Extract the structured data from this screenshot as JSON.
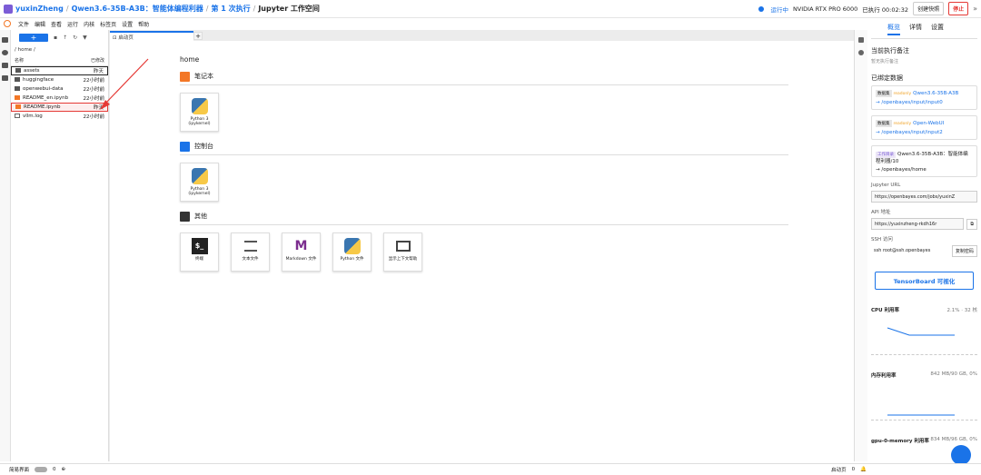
{
  "breadcrumb": {
    "user": "yuxinZheng",
    "project": "Qwen3.6-35B-A3B：智能体编程利器",
    "run": "第 1 次执行",
    "workspace": "Jupyter 工作空间"
  },
  "header": {
    "status": "运行中",
    "gpu": "NVIDIA RTX PRO 6000",
    "timer": "已执行 00:02:32",
    "snapshot": "创建快照",
    "stop": "停止"
  },
  "menu": [
    "文件",
    "编辑",
    "查看",
    "运行",
    "内核",
    "标签页",
    "设置",
    "帮助"
  ],
  "filebrowser": {
    "new_btn": "+",
    "path": "/ home /",
    "col_name": "名称",
    "col_modified": "已修改",
    "files": [
      {
        "name": "assets",
        "time": "昨天",
        "type": "folder"
      },
      {
        "name": "huggingface",
        "time": "22小时前",
        "type": "folder"
      },
      {
        "name": "openwebui-data",
        "time": "22小时前",
        "type": "folder"
      },
      {
        "name": "README_en.ipynb",
        "time": "22小时前",
        "type": "nb"
      },
      {
        "name": "README.ipynb",
        "time": "昨天",
        "type": "nb"
      },
      {
        "name": "vllm.log",
        "time": "22小时前",
        "type": "doc"
      }
    ]
  },
  "tab": {
    "label": "启动页"
  },
  "launcher": {
    "home": "home",
    "notebook_title": "笔记本",
    "console_title": "控制台",
    "other_title": "其他",
    "kernel_label": "Python 3 (ipykernel)",
    "other_items": [
      "终端",
      "文本文件",
      "Markdown 文件",
      "Python 文件",
      "显示上下文帮助"
    ]
  },
  "right": {
    "tabs": [
      "概览",
      "详情",
      "设置"
    ],
    "note_title": "当前执行备注",
    "note_empty": "暂无执行备注",
    "bound_title": "已绑定数据",
    "datasets": [
      {
        "tag": "数据集",
        "ro": "readonly",
        "name": "Qwen3.6-35B-A3B",
        "path": "→ /openbayes/input/input0"
      },
      {
        "tag": "数据集",
        "ro": "readonly",
        "name": "Open-WebUI",
        "path": "→ /openbayes/input/input2"
      }
    ],
    "workdir": {
      "tag": "工作目录",
      "name": "Qwen3.6-35B-A3B：智能体编程利器/10",
      "path": "→ /openbayes/home"
    },
    "jupyter_label": "Jupyter URL",
    "jupyter_url": "https://openbayes.com/jobs/yuxinZ",
    "api_label": "API 地址",
    "api_url": "https://yuxinzheng-rkdh16r",
    "ssh_label": "SSH 访问",
    "ssh_cmd": "ssh root@ssh.openbayes",
    "ssh_btn": "复制密码",
    "tensorboard": "TensorBoard 可视化",
    "cpu_label": "CPU 利用率",
    "cpu_val": "2.1% · 32 核",
    "mem_label": "内存利用率",
    "mem_val": "842 MB/90 GB, 0%",
    "gpu_label": "gpu-0-memory 利用率",
    "gpu_val": "834 MB/96 GB, 0%"
  },
  "statusbar": {
    "mode": "简易界面",
    "count": "0",
    "right_tab": "启动页",
    "right_count": "0"
  }
}
